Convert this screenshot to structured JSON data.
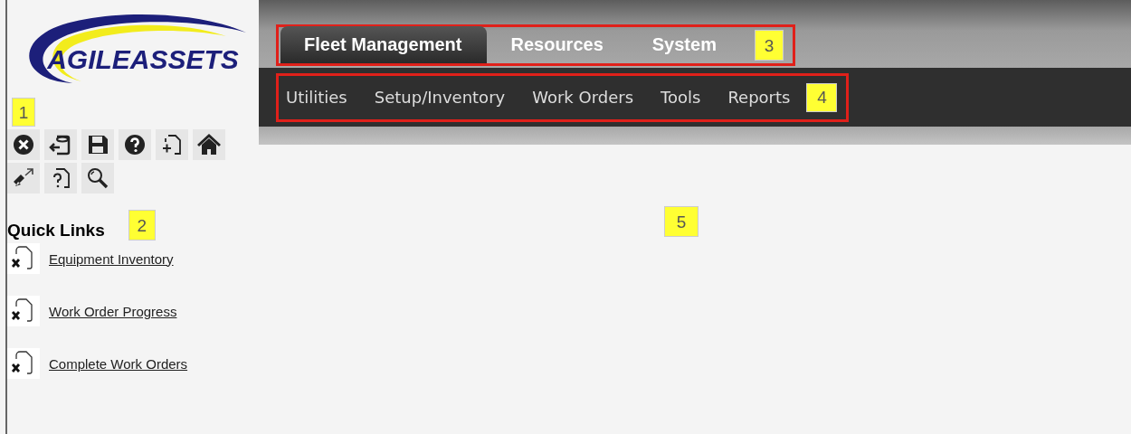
{
  "logo": {
    "text": "AGILEASSETS"
  },
  "toolbar": {
    "callout": "1",
    "icons": [
      {
        "kind": "close"
      },
      {
        "kind": "exit"
      },
      {
        "kind": "save"
      },
      {
        "kind": "help"
      },
      {
        "kind": "new"
      },
      {
        "kind": "home"
      },
      {
        "kind": "link"
      },
      {
        "kind": "doc-help"
      },
      {
        "kind": "search"
      }
    ]
  },
  "quick_links": {
    "title": "Quick Links",
    "callout": "2",
    "items": [
      {
        "label": "Equipment Inventory"
      },
      {
        "label": "Work Order Progress"
      },
      {
        "label": "Complete Work Orders"
      }
    ]
  },
  "main_tabs": {
    "callout": "3",
    "items": [
      {
        "label": "Fleet Management",
        "selected": true
      },
      {
        "label": "Resources",
        "selected": false
      },
      {
        "label": "System",
        "selected": false
      }
    ]
  },
  "sub_menu": {
    "callout": "4",
    "items": [
      {
        "label": "Utilities"
      },
      {
        "label": "Setup/Inventory"
      },
      {
        "label": "Work Orders"
      },
      {
        "label": "Tools"
      },
      {
        "label": "Reports"
      }
    ]
  },
  "content": {
    "callout": "5"
  }
}
